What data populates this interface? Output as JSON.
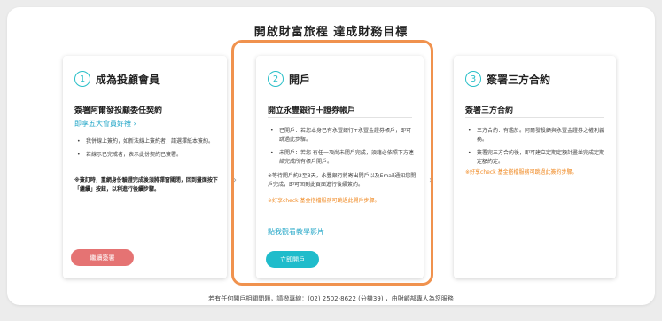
{
  "page": {
    "title": "開啟財富旅程 達成財務目標"
  },
  "steps": [
    {
      "number": "1",
      "title": "成為投顧會員",
      "subtitle": "簽署阿爾發投顧委任契約",
      "link": "即享五大會員好禮 ›",
      "bullets": [
        "我併線上簽約，如新法線上簽約者，請選擇紙本簽約。",
        "若線示已完成者，表示此份契約已簽署。"
      ],
      "note": "※簽訂時，重網身份驗證完成後須將彈窗關閉，回到畫面按下「繼續」按鈕，以利進行後續步驟。",
      "button": "繼續簽署"
    },
    {
      "number": "2",
      "title": "開戶",
      "subtitle": "開立永豐銀行＋證券帳戶",
      "bullets": [
        "已開戶：若您本身已有永豐銀行+永豐金證券帳戶，即可跳過此步驟。",
        "未開戶：若您 有任一項尚未開戶完成，須藉必依照下方連結完成所有帳戶開戶。"
      ],
      "note": "※等待開戶約2至3天，永豐銀行將寄出開戶以及Email通知您開戶完成，即可回到此頁面進行後續簽約。",
      "orange_note": "※好享check 基金搭檔服務可跳過此開戶步驟。",
      "link": "點我觀看教學影片",
      "button": "立即開戶"
    },
    {
      "number": "3",
      "title": "簽署三方合約",
      "subtitle": "簽署三方合約",
      "bullets": [
        "三方合約：有鑑於。阿爾發投顧與永豐金證券之權利義務。",
        "簽署完三方合約後，即可建立定期定額計畫並完成定期定額約定。"
      ],
      "orange_note": "※好享check 基金搭檔服務可跳過此簽約步驟。"
    }
  ],
  "arrows": [
    "›",
    "›"
  ],
  "footer": "若有任何開戶相關問題，請撥專線：(02) 2502-8622 (分機39) ，由財顧部專人為您服務",
  "colors": {
    "accent": "#29bfc8",
    "highlight": "#f0924e",
    "danger_button": "#e57373",
    "warning_text": "#f08a24"
  }
}
